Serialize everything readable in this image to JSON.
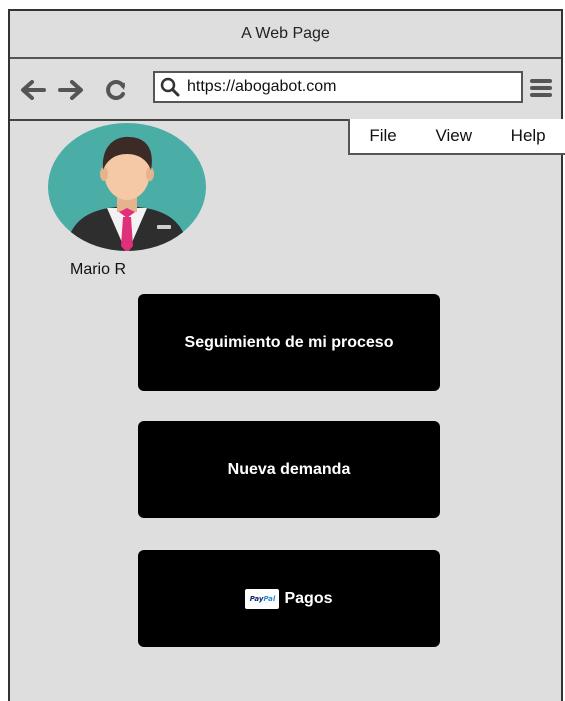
{
  "window": {
    "title": "A Web Page"
  },
  "toolbar": {
    "url": "https://abogabot.com",
    "icons": [
      "back-arrow-icon",
      "forward-arrow-icon",
      "reload-icon",
      "search-icon",
      "hamburger-menu-icon"
    ]
  },
  "menu": {
    "items": [
      "File",
      "View",
      "Help"
    ]
  },
  "profile": {
    "name": "Mario R"
  },
  "actions": {
    "seguimiento": "Seguimiento de mi proceso",
    "nueva_demanda": "Nueva demanda",
    "pagos": "Pagos",
    "paypal_badge": {
      "part1": "Pay",
      "part2": "Pal"
    }
  },
  "colors": {
    "window_bg": "#dedede",
    "button_bg": "#000000",
    "avatar_bg": "#4aaea6",
    "tie": "#e0307a"
  }
}
